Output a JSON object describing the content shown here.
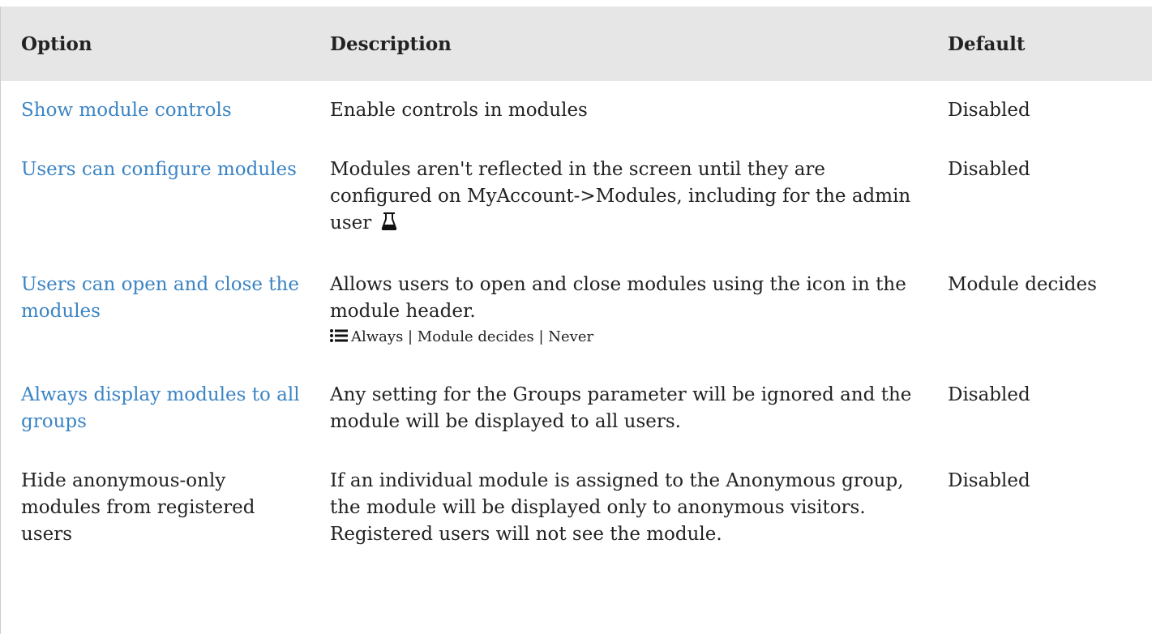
{
  "headers": {
    "option": "Option",
    "description": "Description",
    "default": "Default"
  },
  "rows": [
    {
      "option": "Show module controls",
      "option_is_link": true,
      "description": "Enable controls in modules",
      "default": "Disabled"
    },
    {
      "option": "Users can configure modules",
      "option_is_link": true,
      "description": "Modules aren't reflected in the screen until they are configured on MyAccount->Modules, including for the admin user",
      "description_icon": "flask-icon",
      "default": "Disabled"
    },
    {
      "option": "Users can open and close the modules",
      "option_is_link": true,
      "description": "Allows users to open and close modules using the icon in the module header.",
      "options_list": "Always | Module decides | Never",
      "options_icon": "list-icon",
      "default": "Module decides"
    },
    {
      "option": "Always display modules to all groups",
      "option_is_link": true,
      "description": "Any setting for the Groups parameter will be ignored and the module will be displayed to all users.",
      "default": "Disabled"
    },
    {
      "option": "Hide anonymous-only modules from registered users",
      "option_is_link": false,
      "description": "If an individual module is assigned to the Anonymous group, the module will be displayed only to anonymous visitors. Registered users will not see the module.",
      "default": "Disabled"
    }
  ],
  "colors": {
    "link": "#3b84c4",
    "header_bg": "#e6e6e6",
    "text": "#222222"
  }
}
